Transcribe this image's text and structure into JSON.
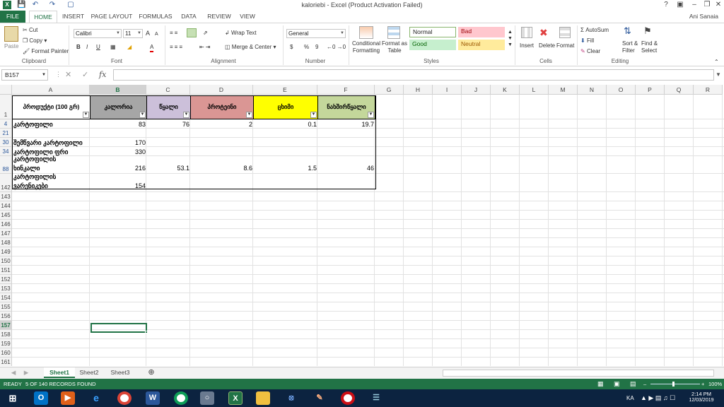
{
  "window": {
    "title": "kaloriebi - Excel (Product Activation Failed)",
    "help": "?",
    "user": "Ani Sanaia"
  },
  "tabs": [
    "FILE",
    "HOME",
    "INSERT",
    "PAGE LAYOUT",
    "FORMULAS",
    "DATA",
    "REVIEW",
    "VIEW"
  ],
  "ribbon": {
    "clipboard": {
      "paste": "Paste",
      "cut": "Cut",
      "copy": "Copy",
      "format_painter": "Format Painter",
      "label": "Clipboard"
    },
    "font": {
      "name": "Calibri",
      "size": "11",
      "bold": "B",
      "italic": "I",
      "underline": "U",
      "grow": "A",
      "shrink": "A",
      "label": "Font"
    },
    "alignment": {
      "wrap": "Wrap Text",
      "merge": "Merge & Center",
      "label": "Alignment"
    },
    "number": {
      "format": "General",
      "currency": "$",
      "percent": "%",
      "comma": "9",
      "label": "Number"
    },
    "styles": {
      "conditional": "Conditional Formatting",
      "format_table": "Format as Table",
      "normal": "Normal",
      "bad": "Bad",
      "good": "Good",
      "neutral": "Neutral",
      "label": "Styles"
    },
    "cells": {
      "insert": "Insert",
      "delete": "Delete",
      "format": "Format",
      "label": "Cells"
    },
    "editing": {
      "autosum": "AutoSum",
      "fill": "Fill",
      "clear": "Clear",
      "sort": "Sort & Filter",
      "find": "Find & Select",
      "label": "Editing"
    }
  },
  "formula_bar": {
    "name_box": "B157",
    "fx": "fx",
    "value": ""
  },
  "columns": [
    "A",
    "B",
    "C",
    "D",
    "E",
    "F",
    "G",
    "H",
    "I",
    "J",
    "K",
    "L",
    "M",
    "N",
    "O",
    "P",
    "Q",
    "R"
  ],
  "rows": [
    "1",
    "4",
    "21",
    "30",
    "34",
    "88",
    "142",
    "143",
    "144",
    "145",
    "146",
    "147",
    "148",
    "149",
    "150",
    "151",
    "152",
    "153",
    "154",
    "155",
    "156",
    "157",
    "158",
    "159",
    "160",
    "161"
  ],
  "table": {
    "headers": [
      "პროდუქტი (100 გრ)",
      "კალორია",
      "წყალი",
      "პროტეინი",
      "ცხიმი",
      "ნახშირწყალი"
    ],
    "header_colors": [
      "#ffffff",
      "#a6a6a6",
      "#ccc0da",
      "#da9694",
      "#ffff00",
      "#c4d79b"
    ],
    "rows": [
      {
        "a": "კარტოფილი",
        "b": "83",
        "c": "76",
        "d": "2",
        "e": "0.1",
        "f": "19.7"
      },
      {
        "a": "შემწვარი კარტოფილი",
        "b": "170",
        "c": "",
        "d": "",
        "e": "",
        "f": ""
      },
      {
        "a": "კარტოფილი ფრი",
        "b": "330",
        "c": "",
        "d": "",
        "e": "",
        "f": ""
      },
      {
        "a1": "კარტოფილის",
        "a2": "ხინკალი",
        "b": "216",
        "c": "53.1",
        "d": "8.6",
        "e": "1.5",
        "f": "46"
      },
      {
        "a1": "კარტოფილის",
        "a2": "ვარენიკები",
        "b": "154",
        "c": "",
        "d": "",
        "e": "",
        "f": ""
      }
    ]
  },
  "sheets": [
    "Sheet1",
    "Sheet2",
    "Sheet3"
  ],
  "status": {
    "ready": "READY",
    "records": "5 OF 140 RECORDS FOUND",
    "zoom": "100%"
  },
  "taskbar": {
    "lang": "KA",
    "time": "2:14 PM",
    "date": "12/03/2019"
  }
}
